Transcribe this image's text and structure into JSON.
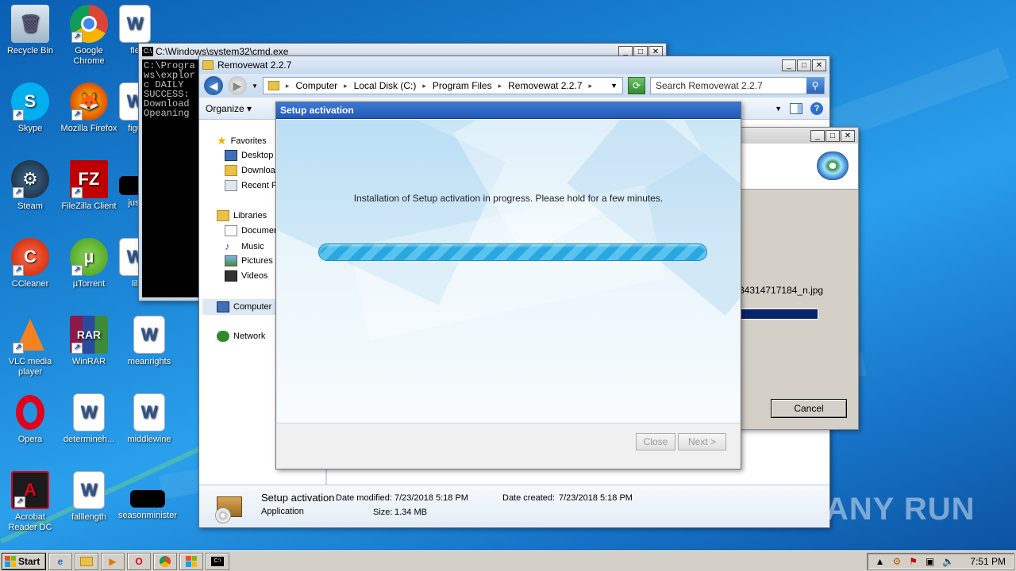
{
  "desktop": {
    "icons": [
      {
        "label": "Recycle Bin"
      },
      {
        "label": "Google Chrome"
      },
      {
        "label": "fie"
      },
      {
        "label": "Skype"
      },
      {
        "label": "Mozilla Firefox"
      },
      {
        "label": "figu"
      },
      {
        "label": "Steam"
      },
      {
        "label": "FileZilla Client"
      },
      {
        "label": "just"
      },
      {
        "label": "CCleaner"
      },
      {
        "label": "µTorrent"
      },
      {
        "label": "lil"
      },
      {
        "label": "VLC media player"
      },
      {
        "label": "WinRAR"
      },
      {
        "label": "meanrights"
      },
      {
        "label": "Opera"
      },
      {
        "label": "determineh..."
      },
      {
        "label": "middlewine"
      },
      {
        "label": "Acrobat Reader DC"
      },
      {
        "label": "falllength"
      },
      {
        "label": "seasonminister"
      }
    ]
  },
  "cmd": {
    "title": "C:\\Windows\\system32\\cmd.exe",
    "lines": "C:\\Progra\nws\\explor\nc DAILY\nSUCCESS:\nDownload\nOpeaning"
  },
  "explorer": {
    "title": "Removewat 2.2.7",
    "breadcrumb": [
      "Computer",
      "Local Disk (C:)",
      "Program Files",
      "Removewat 2.2.7"
    ],
    "search_placeholder": "Search Removewat 2.2.7",
    "organize": "Organize",
    "nav": {
      "favorites": "Favorites",
      "desktop": "Desktop",
      "downloads": "Downloa",
      "recent": "Recent P",
      "libraries": "Libraries",
      "documents": "Documen",
      "music": "Music",
      "pictures": "Pictures",
      "videos": "Videos",
      "computer": "Computer",
      "network": "Network"
    },
    "details": {
      "name": "Setup activation",
      "type": "Application",
      "modified_label": "Date modified:",
      "modified": "7/23/2018 5:18 PM",
      "created_label": "Date created:",
      "created": "7/23/2018 5:18 PM",
      "size_label": "Size:",
      "size": "1.34 MB"
    }
  },
  "setup_window": {
    "filename": "34314717184_n.jpg",
    "cancel": "Cancel"
  },
  "dialog": {
    "title": "Setup activation",
    "message": "Installation of Setup activation in progress. Please hold for a few minutes.",
    "close": "Close",
    "next": "Next >",
    "progress_percent": 100
  },
  "taskbar": {
    "start": "Start",
    "time": "7:51 PM"
  },
  "watermark": "ANY RUN"
}
